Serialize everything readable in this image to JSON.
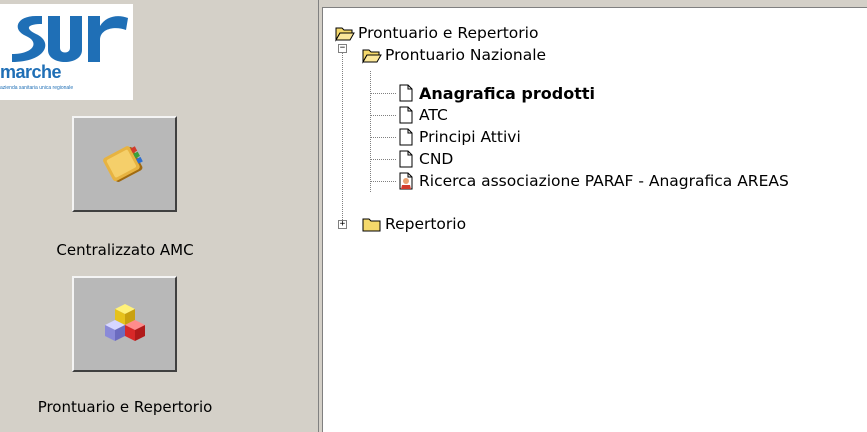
{
  "logo": {
    "brand": "sur",
    "region": "marche",
    "subtitle": "azienda sanitaria unica regionale"
  },
  "apps": [
    {
      "label": "Centralizzato AMC",
      "icon": "address-book-icon"
    },
    {
      "label": "Prontuario e Repertorio",
      "icon": "colored-cubes-icon"
    }
  ],
  "tree": {
    "root": {
      "label": "Prontuario e Repertorio",
      "icon": "open-folder-icon"
    },
    "nazionale": {
      "label": "Prontuario Nazionale",
      "icon": "open-folder-icon",
      "expander": "−",
      "children": [
        {
          "label": "Anagrafica prodotti",
          "icon": "document-icon",
          "selected": true
        },
        {
          "label": "ATC",
          "icon": "document-icon"
        },
        {
          "label": "Principi Attivi",
          "icon": "document-icon"
        },
        {
          "label": "CND",
          "icon": "document-icon"
        },
        {
          "label": "Ricerca associazione PARAF - Anagrafica AREAS",
          "icon": "document-user-icon"
        }
      ]
    },
    "repertorio": {
      "label": "Repertorio",
      "icon": "closed-folder-icon",
      "expander": "+"
    }
  },
  "colors": {
    "panel_bg": "#d4d0c8",
    "button_bg": "#b8b8b8",
    "logo_blue": "#1f6fb6",
    "folder_yellow": "#f5d96b"
  }
}
